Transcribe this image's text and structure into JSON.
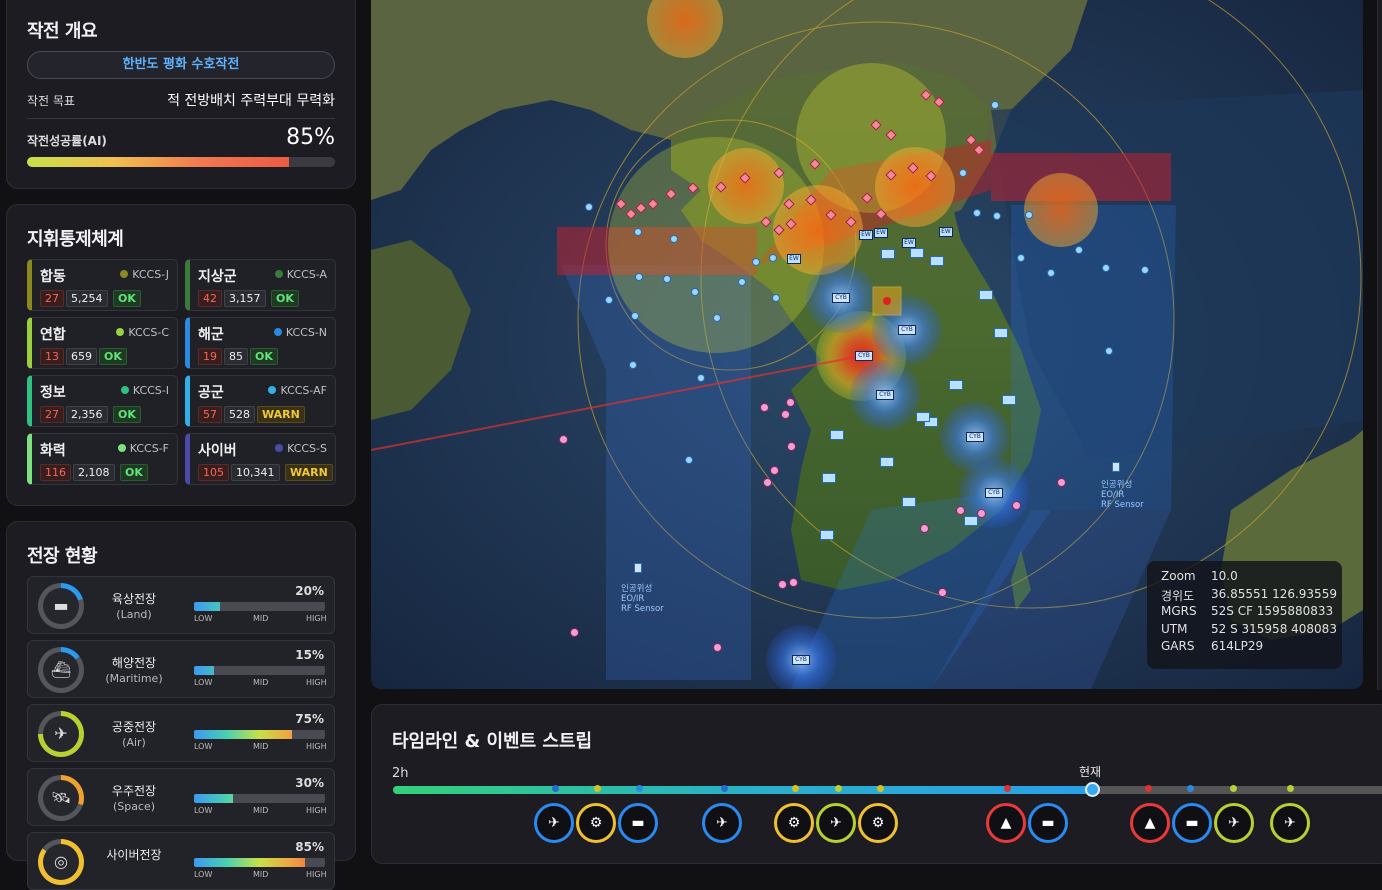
{
  "overview": {
    "title": "작전 개요",
    "operation_name": "한반도 평화 수호작전",
    "objective_label": "작전 목표",
    "objective_value": "적 전방배치 주력부대 무력화",
    "success_label": "작전성공률(AI)",
    "success_value": "85%",
    "success_fraction": 0.85
  },
  "c2": {
    "title": "지휘통제체계",
    "units": [
      {
        "name": "합동",
        "system": "KCCS-J",
        "color": "#8a8a20",
        "alerts": "27",
        "count": "5,254",
        "status": "OK"
      },
      {
        "name": "지상군",
        "system": "KCCS-A",
        "color": "#3a7a3a",
        "alerts": "42",
        "count": "3,157",
        "status": "OK"
      },
      {
        "name": "연합",
        "system": "KCCS-C",
        "color": "#9ad040",
        "alerts": "13",
        "count": "659",
        "status": "OK"
      },
      {
        "name": "해군",
        "system": "KCCS-N",
        "color": "#2a8ae0",
        "alerts": "19",
        "count": "85",
        "status": "OK"
      },
      {
        "name": "정보",
        "system": "KCCS-I",
        "color": "#30c080",
        "alerts": "27",
        "count": "2,356",
        "status": "OK"
      },
      {
        "name": "공군",
        "system": "KCCS-AF",
        "color": "#30b0e8",
        "alerts": "57",
        "count": "528",
        "status": "WARN"
      },
      {
        "name": "화력",
        "system": "KCCS-F",
        "color": "#80e080",
        "alerts": "116",
        "count": "2,108",
        "status": "OK"
      },
      {
        "name": "사이버",
        "system": "KCCS-S",
        "color": "#4a4aa8",
        "alerts": "105",
        "count": "10,341",
        "status": "WARN"
      }
    ]
  },
  "battlefield": {
    "title": "전장 현황",
    "scale_low": "LOW",
    "scale_mid": "MID",
    "scale_high": "HIGH",
    "domains": [
      {
        "name": "육상전장",
        "sub": "(Land)",
        "pct": "20%",
        "value": 0.2,
        "ring_color": "#2a9af0",
        "icon": "tank-icon",
        "glyph": "▬"
      },
      {
        "name": "해양전장",
        "sub": "(Maritime)",
        "pct": "15%",
        "value": 0.15,
        "ring_color": "#2a9af0",
        "icon": "ship-icon",
        "glyph": "⛴"
      },
      {
        "name": "공중전장",
        "sub": "(Air)",
        "pct": "75%",
        "value": 0.75,
        "ring_color": "#b8d030",
        "icon": "jet-icon",
        "glyph": "✈"
      },
      {
        "name": "우주전장",
        "sub": "(Space)",
        "pct": "30%",
        "value": 0.3,
        "ring_color": "#f0a030",
        "icon": "satellite-icon",
        "glyph": "🛰"
      },
      {
        "name": "사이버전장",
        "sub": "",
        "pct": "85%",
        "value": 0.85,
        "ring_color": "#f0c030",
        "icon": "cyber-icon",
        "glyph": "◎"
      }
    ]
  },
  "map": {
    "coords": [
      {
        "label": "Zoom",
        "value": "10.0"
      },
      {
        "label": "경위도",
        "value": "36.85551 126.93559"
      },
      {
        "label": "MGRS",
        "value": "52S CF 1595880833"
      },
      {
        "label": "UTM",
        "value": "52 S 315958 408083"
      },
      {
        "label": "GARS",
        "value": "614LP29"
      }
    ],
    "sensor_left": [
      "인공위성",
      "EO/IR",
      "RF Sensor"
    ],
    "sensor_right": [
      "인공위성",
      "EO/IR",
      "RF Sensor"
    ],
    "marker_labels": {
      "cyb": "CYB",
      "ew": "EW"
    }
  },
  "timeline": {
    "title": "타임라인 & 이벤트 스트립",
    "start_label": "2h",
    "now_label": "현재",
    "progress": 0.7,
    "events": [
      {
        "icon": "drone-icon",
        "glyph": "✈",
        "color": "#2a8af0"
      },
      {
        "icon": "cyber-icon",
        "glyph": "⚙",
        "color": "#f0c030"
      },
      {
        "icon": "tank-icon",
        "glyph": "▬",
        "color": "#2a8af0"
      },
      {
        "icon": "drone-icon",
        "glyph": "✈",
        "color": "#2a8af0"
      },
      {
        "icon": "cyber-icon",
        "glyph": "⚙",
        "color": "#f0c030"
      },
      {
        "icon": "jet-icon",
        "glyph": "✈",
        "color": "#b8d030"
      },
      {
        "icon": "cyber-icon",
        "glyph": "⚙",
        "color": "#f0c030"
      },
      {
        "icon": "missile-icon",
        "glyph": "▲",
        "color": "#e83a3a"
      },
      {
        "icon": "tank-icon",
        "glyph": "▬",
        "color": "#2a8af0"
      },
      {
        "icon": "missile-icon",
        "glyph": "▲",
        "color": "#e83a3a"
      },
      {
        "icon": "tank-icon",
        "glyph": "▬",
        "color": "#2a8af0"
      },
      {
        "icon": "jet-icon",
        "glyph": "✈",
        "color": "#b8d030"
      },
      {
        "icon": "jet-icon",
        "glyph": "✈",
        "color": "#b8d030"
      }
    ]
  }
}
